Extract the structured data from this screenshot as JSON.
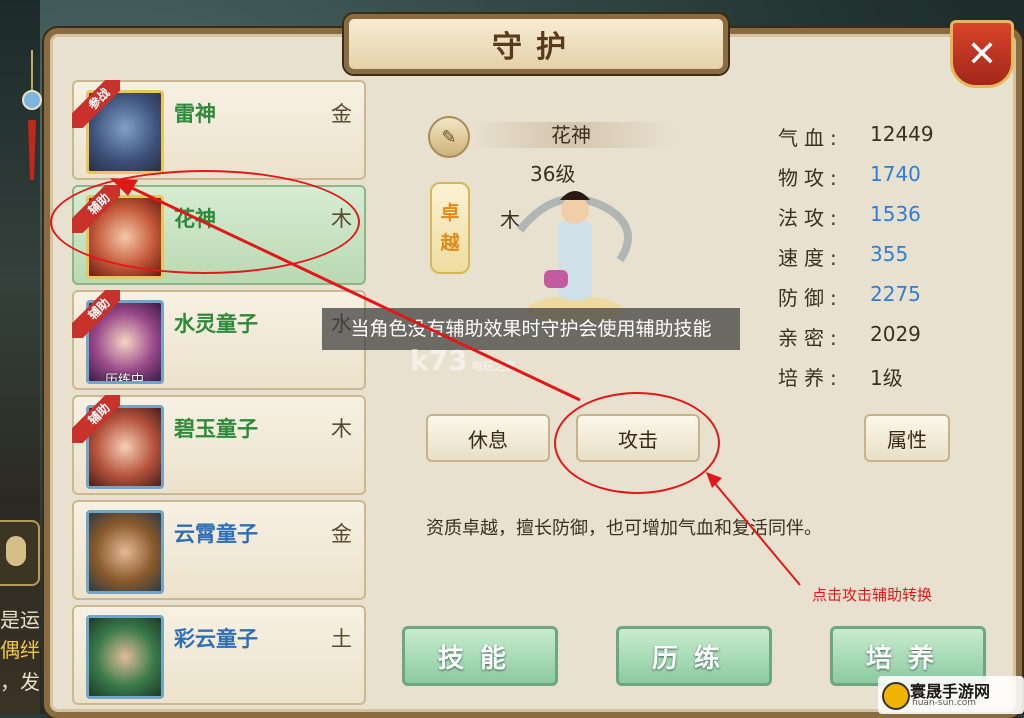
{
  "title": "守护",
  "close_label": "✕",
  "companions": [
    {
      "name": "雷神",
      "element": "金",
      "badge": "参战",
      "name_color": "green"
    },
    {
      "name": "花神",
      "element": "木",
      "badge": "辅助",
      "name_color": "green",
      "selected": true
    },
    {
      "name": "水灵童子",
      "element": "水",
      "badge": "辅助",
      "name_color": "green",
      "status": "历练中"
    },
    {
      "name": "碧玉童子",
      "element": "木",
      "badge": "辅助",
      "name_color": "green"
    },
    {
      "name": "云霄童子",
      "element": "金",
      "badge": "",
      "name_color": "blue"
    },
    {
      "name": "彩云童子",
      "element": "土",
      "badge": "",
      "name_color": "blue"
    }
  ],
  "detail": {
    "name": "花神",
    "level": "36级",
    "grade": [
      "卓",
      "越"
    ],
    "element": "木",
    "stats": [
      {
        "key": "气血:",
        "value": "12449",
        "color": "#3a3020"
      },
      {
        "key": "物攻:",
        "value": "1740",
        "color": "#2e7ed6"
      },
      {
        "key": "法攻:",
        "value": "1536",
        "color": "#2e7ed6"
      },
      {
        "key": "速度:",
        "value": "355",
        "color": "#2e7ed6"
      },
      {
        "key": "防御:",
        "value": "2275",
        "color": "#2e7ed6"
      },
      {
        "key": "亲密:",
        "value": "2029",
        "color": "#3a3020"
      },
      {
        "key": "培养:",
        "value": "1级",
        "color": "#3a3020"
      }
    ],
    "description": "资质卓越，擅长防御，也可增加气血和复活同伴。"
  },
  "tooltip": "当角色没有辅助效果时守护会使用辅助技能",
  "buttons": {
    "rest": "休息",
    "attack": "攻击",
    "attributes": "属性",
    "skills": "技能",
    "training": "历练",
    "cultivate": "培养"
  },
  "annotation": "点击攻击辅助转换",
  "watermark": "k73",
  "watermark_sub": "电玩之家",
  "chat_snippets": [
    "是运",
    "偶绊",
    "，发"
  ],
  "site_logo": {
    "main": "寰晟手游网",
    "sub": "huan-sun.com"
  }
}
